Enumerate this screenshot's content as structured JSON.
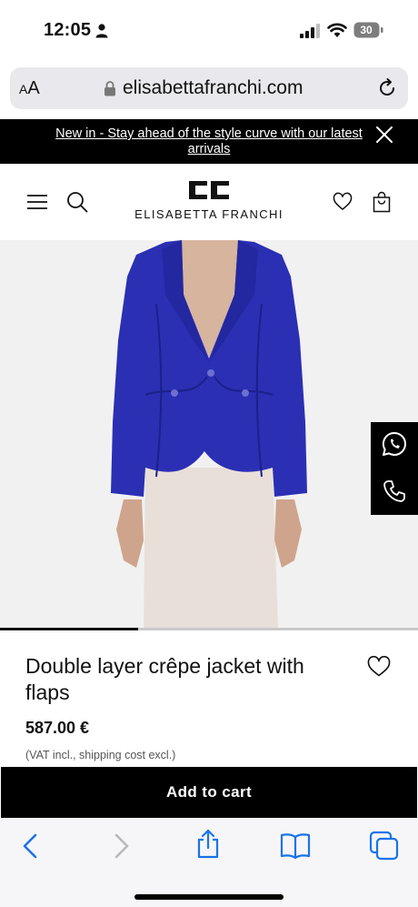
{
  "status_bar": {
    "time": "12:05",
    "battery": "30"
  },
  "browser": {
    "reader_label_small": "A",
    "reader_label_large": "A",
    "url": "elisabettafranchi.com"
  },
  "banner": {
    "text": "New in - Stay ahead of the style curve with our latest arrivals"
  },
  "header": {
    "brand": "ELISABETTA FRANCHI"
  },
  "gallery": {
    "progress_fraction": 0.33
  },
  "product": {
    "title": "Double layer crêpe jacket with flaps",
    "price": "587.00 €",
    "vat_note": "(VAT incl., shipping cost excl.)",
    "add_to_cart_label": "Add to cart"
  },
  "colors": {
    "jacket": "#2b2fb3",
    "skirt": "#e8dfd9",
    "banner_bg": "#000000",
    "safari_accent": "#1a73e8"
  },
  "icons": [
    "person-icon",
    "signal-icon",
    "wifi-icon",
    "battery-icon",
    "lock-icon",
    "reload-icon",
    "close-icon",
    "menu-icon",
    "search-icon",
    "heart-icon",
    "bag-icon",
    "whatsapp-icon",
    "phone-icon",
    "back-icon",
    "forward-icon",
    "share-icon",
    "bookmarks-icon",
    "tabs-icon"
  ]
}
